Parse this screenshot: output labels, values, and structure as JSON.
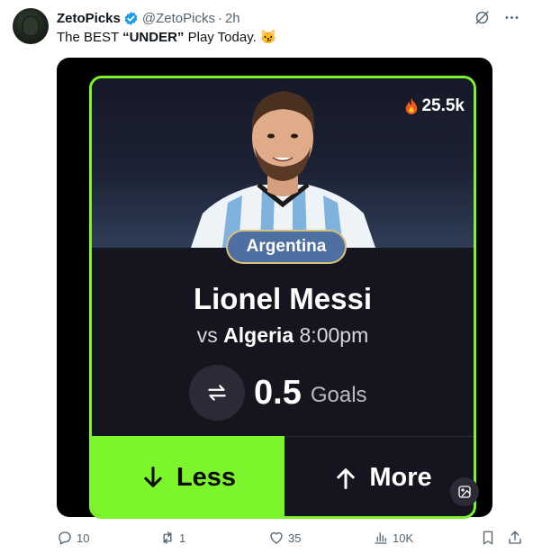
{
  "tweet": {
    "author_name": "ZetoPicks",
    "handle": "@ZetoPicks",
    "separator": "·",
    "time": "2h",
    "text_before": "The BEST ",
    "text_bold": "“UNDER”",
    "text_after": " Play Today. 😼"
  },
  "card": {
    "views_count": "25.5k",
    "team_badge": "Argentina",
    "player_name": "Lionel Messi",
    "vs_label": "vs",
    "opponent": "Algeria",
    "match_time": "8:00pm",
    "line_value": "0.5",
    "stat_unit": "Goals",
    "less_label": "Less",
    "more_label": "More"
  },
  "actions": {
    "replies": "10",
    "reposts": "1",
    "likes": "35",
    "views": "10K"
  },
  "colors": {
    "accent_green": "#7cf52d",
    "card_bg": "#151520",
    "badge_bg": "#4e6fa1",
    "verified_blue": "#1d9bf0"
  }
}
